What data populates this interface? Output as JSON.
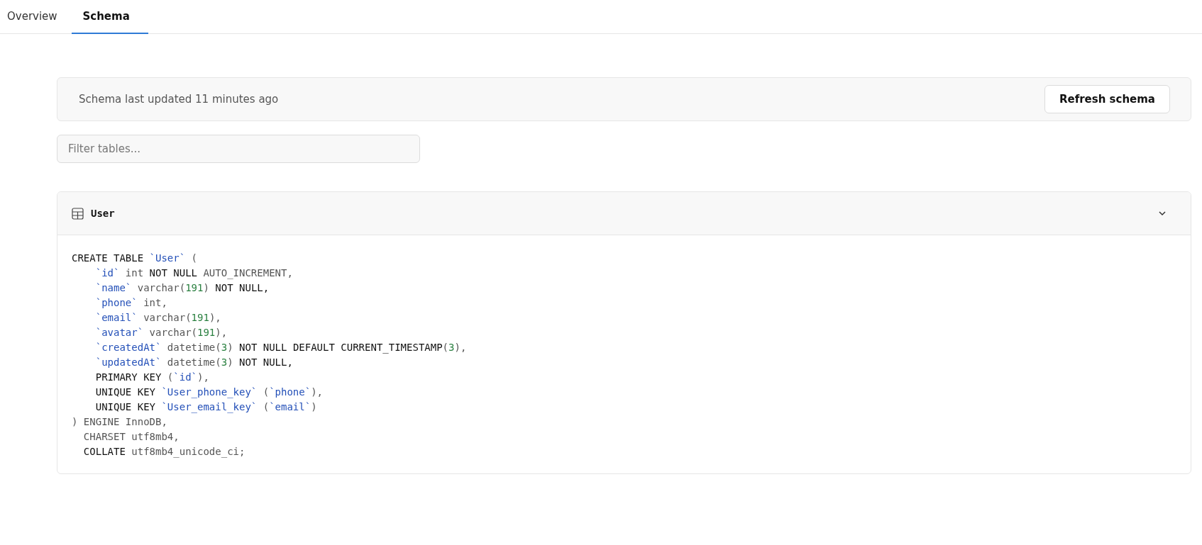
{
  "tabs": [
    {
      "label": "Overview",
      "selected": false
    },
    {
      "label": "Schema",
      "selected": true
    }
  ],
  "status": {
    "text": "Schema last updated 11 minutes ago",
    "button": "Refresh schema"
  },
  "filter": {
    "placeholder": "Filter tables..."
  },
  "table_card": {
    "name": "User",
    "expanded": true,
    "lines": [
      {
        "kind": "statement",
        "tokens": [
          {
            "kind": "keyword",
            "text": "CREATE TABLE"
          },
          {
            "kind": "ident",
            "text": " `User`"
          },
          {
            "kind": "plain",
            "text": " ("
          }
        ]
      },
      {
        "kind": "column",
        "tokens": [
          {
            "kind": "ident",
            "text": "`id`"
          },
          {
            "kind": "plain",
            "text": " int"
          },
          {
            "kind": "keyword",
            "text": " NOT NULL"
          },
          {
            "kind": "plain",
            "text": " AUTO_INCREMENT,"
          }
        ]
      },
      {
        "kind": "column",
        "tokens": [
          {
            "kind": "ident",
            "text": "`name`"
          },
          {
            "kind": "plain",
            "text": " varchar("
          },
          {
            "kind": "number",
            "text": "191"
          },
          {
            "kind": "plain",
            "text": ")"
          },
          {
            "kind": "keyword",
            "text": " NOT NULL,"
          }
        ]
      },
      {
        "kind": "column",
        "tokens": [
          {
            "kind": "ident",
            "text": "`phone`"
          },
          {
            "kind": "plain",
            "text": " int,"
          }
        ]
      },
      {
        "kind": "column",
        "tokens": [
          {
            "kind": "ident",
            "text": "`email`"
          },
          {
            "kind": "plain",
            "text": " varchar("
          },
          {
            "kind": "number",
            "text": "191"
          },
          {
            "kind": "plain",
            "text": "),"
          }
        ]
      },
      {
        "kind": "column",
        "tokens": [
          {
            "kind": "ident",
            "text": "`avatar`"
          },
          {
            "kind": "plain",
            "text": " varchar("
          },
          {
            "kind": "number",
            "text": "191"
          },
          {
            "kind": "plain",
            "text": "),"
          }
        ]
      },
      {
        "kind": "column",
        "tokens": [
          {
            "kind": "ident",
            "text": "`createdAt`"
          },
          {
            "kind": "plain",
            "text": " datetime("
          },
          {
            "kind": "number",
            "text": "3"
          },
          {
            "kind": "plain",
            "text": ")"
          },
          {
            "kind": "keyword",
            "text": " NOT NULL DEFAULT CURRENT_TIMESTAMP"
          },
          {
            "kind": "plain",
            "text": "("
          },
          {
            "kind": "number",
            "text": "3"
          },
          {
            "kind": "plain",
            "text": "),"
          }
        ]
      },
      {
        "kind": "column",
        "tokens": [
          {
            "kind": "ident",
            "text": "`updatedAt`"
          },
          {
            "kind": "plain",
            "text": " datetime("
          },
          {
            "kind": "number",
            "text": "3"
          },
          {
            "kind": "plain",
            "text": ")"
          },
          {
            "kind": "keyword",
            "text": " NOT NULL,"
          }
        ]
      },
      {
        "kind": "column",
        "tokens": [
          {
            "kind": "keyword",
            "text": "PRIMARY KEY"
          },
          {
            "kind": "plain",
            "text": " ("
          },
          {
            "kind": "ident",
            "text": "`id`"
          },
          {
            "kind": "plain",
            "text": "),"
          }
        ]
      },
      {
        "kind": "column",
        "tokens": [
          {
            "kind": "keyword",
            "text": "UNIQUE KEY"
          },
          {
            "kind": "ident",
            "text": " `User_phone_key`"
          },
          {
            "kind": "plain",
            "text": " ("
          },
          {
            "kind": "ident",
            "text": "`phone`"
          },
          {
            "kind": "plain",
            "text": "),"
          }
        ]
      },
      {
        "kind": "column",
        "tokens": [
          {
            "kind": "keyword",
            "text": "UNIQUE KEY"
          },
          {
            "kind": "ident",
            "text": " `User_email_key`"
          },
          {
            "kind": "plain",
            "text": " ("
          },
          {
            "kind": "ident",
            "text": "`email`"
          },
          {
            "kind": "plain",
            "text": ")"
          }
        ]
      },
      {
        "kind": "statement",
        "tokens": [
          {
            "kind": "plain",
            "text": ") ENGINE InnoDB,"
          }
        ]
      },
      {
        "kind": "option",
        "tokens": [
          {
            "kind": "plain",
            "text": "CHARSET utf8mb4,"
          }
        ]
      },
      {
        "kind": "option",
        "tokens": [
          {
            "kind": "keyword",
            "text": "COLLATE"
          },
          {
            "kind": "plain",
            "text": " utf8mb4_unicode_ci;"
          }
        ]
      }
    ]
  }
}
